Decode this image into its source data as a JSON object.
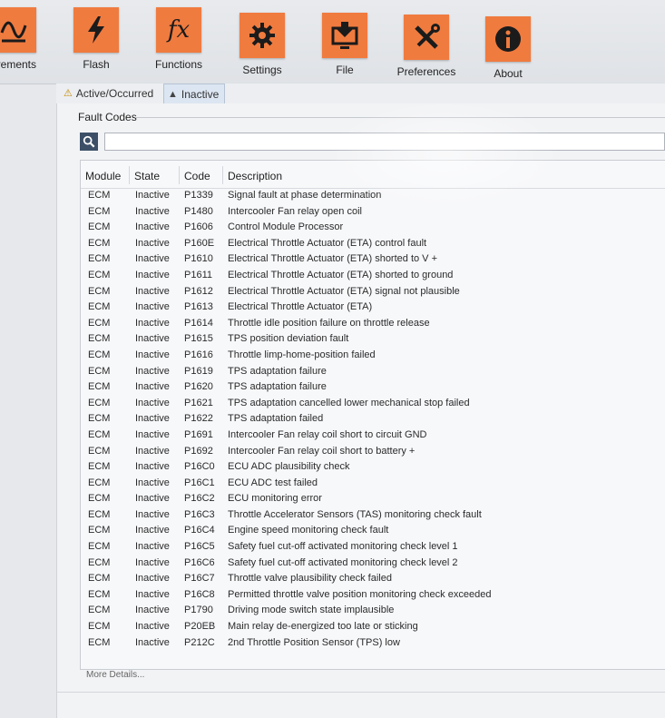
{
  "toolbar": {
    "items": [
      {
        "label": "urements",
        "icon": "chart-line-icon"
      },
      {
        "label": "Flash",
        "icon": "lightning-icon"
      },
      {
        "label": "Functions",
        "icon": "fx-icon"
      },
      {
        "label": "Settings",
        "icon": "gear-icon"
      },
      {
        "label": "File",
        "icon": "download-monitor-icon"
      },
      {
        "label": "Preferences",
        "icon": "tools-icon"
      },
      {
        "label": "About",
        "icon": "info-icon"
      }
    ],
    "fx_text": "fx",
    "accent": "#f07b3f"
  },
  "tabs": {
    "active_occurred": "Active/Occurred",
    "inactive": "Inactive"
  },
  "fault_codes": {
    "group_label": "Fault Codes",
    "search_value": "",
    "columns": {
      "module": "Module",
      "state": "State",
      "code": "Code",
      "description": "Description"
    },
    "rows": [
      {
        "module": "ECM",
        "state": "Inactive",
        "code": "P1339",
        "description": "Signal fault at phase determination"
      },
      {
        "module": "ECM",
        "state": "Inactive",
        "code": "P1480",
        "description": "Intercooler Fan relay open coil"
      },
      {
        "module": "ECM",
        "state": "Inactive",
        "code": "P1606",
        "description": "Control Module Processor"
      },
      {
        "module": "ECM",
        "state": "Inactive",
        "code": "P160E",
        "description": "Electrical Throttle Actuator (ETA) control fault"
      },
      {
        "module": "ECM",
        "state": "Inactive",
        "code": "P1610",
        "description": "Electrical Throttle Actuator (ETA) shorted to V +"
      },
      {
        "module": "ECM",
        "state": "Inactive",
        "code": "P1611",
        "description": "Electrical Throttle Actuator (ETA) shorted to ground"
      },
      {
        "module": "ECM",
        "state": "Inactive",
        "code": "P1612",
        "description": "Electrical Throttle Actuator (ETA) signal not plausible"
      },
      {
        "module": "ECM",
        "state": "Inactive",
        "code": "P1613",
        "description": "Electrical Throttle Actuator (ETA)"
      },
      {
        "module": "ECM",
        "state": "Inactive",
        "code": "P1614",
        "description": "Throttle idle position failure on throttle release"
      },
      {
        "module": "ECM",
        "state": "Inactive",
        "code": "P1615",
        "description": "TPS position deviation fault"
      },
      {
        "module": "ECM",
        "state": "Inactive",
        "code": "P1616",
        "description": "Throttle limp-home-position failed"
      },
      {
        "module": "ECM",
        "state": "Inactive",
        "code": "P1619",
        "description": "TPS adaptation failure"
      },
      {
        "module": "ECM",
        "state": "Inactive",
        "code": "P1620",
        "description": "TPS adaptation failure"
      },
      {
        "module": "ECM",
        "state": "Inactive",
        "code": "P1621",
        "description": "TPS adaptation cancelled lower mechanical stop failed"
      },
      {
        "module": "ECM",
        "state": "Inactive",
        "code": "P1622",
        "description": "TPS adaptation failed"
      },
      {
        "module": "ECM",
        "state": "Inactive",
        "code": "P1691",
        "description": "Intercooler Fan relay coil short to circuit GND"
      },
      {
        "module": "ECM",
        "state": "Inactive",
        "code": "P1692",
        "description": "Intercooler Fan relay coil short to battery +"
      },
      {
        "module": "ECM",
        "state": "Inactive",
        "code": "P16C0",
        "description": "ECU ADC plausibility check"
      },
      {
        "module": "ECM",
        "state": "Inactive",
        "code": "P16C1",
        "description": "ECU ADC test failed"
      },
      {
        "module": "ECM",
        "state": "Inactive",
        "code": "P16C2",
        "description": "ECU monitoring error"
      },
      {
        "module": "ECM",
        "state": "Inactive",
        "code": "P16C3",
        "description": "Throttle Accelerator Sensors (TAS) monitoring check fault"
      },
      {
        "module": "ECM",
        "state": "Inactive",
        "code": "P16C4",
        "description": "Engine speed monitoring check fault"
      },
      {
        "module": "ECM",
        "state": "Inactive",
        "code": "P16C5",
        "description": "Safety fuel cut-off activated monitoring check level 1"
      },
      {
        "module": "ECM",
        "state": "Inactive",
        "code": "P16C6",
        "description": "Safety fuel cut-off activated monitoring check level 2"
      },
      {
        "module": "ECM",
        "state": "Inactive",
        "code": "P16C7",
        "description": "Throttle valve plausibility check failed"
      },
      {
        "module": "ECM",
        "state": "Inactive",
        "code": "P16C8",
        "description": "Permitted throttle valve position monitoring check exceeded"
      },
      {
        "module": "ECM",
        "state": "Inactive",
        "code": "P1790",
        "description": "Driving mode switch state implausible"
      },
      {
        "module": "ECM",
        "state": "Inactive",
        "code": "P20EB",
        "description": "Main relay de-energized too late or sticking"
      },
      {
        "module": "ECM",
        "state": "Inactive",
        "code": "P212C",
        "description": "2nd Throttle Position Sensor (TPS) low"
      }
    ],
    "more_details": "More Details..."
  }
}
